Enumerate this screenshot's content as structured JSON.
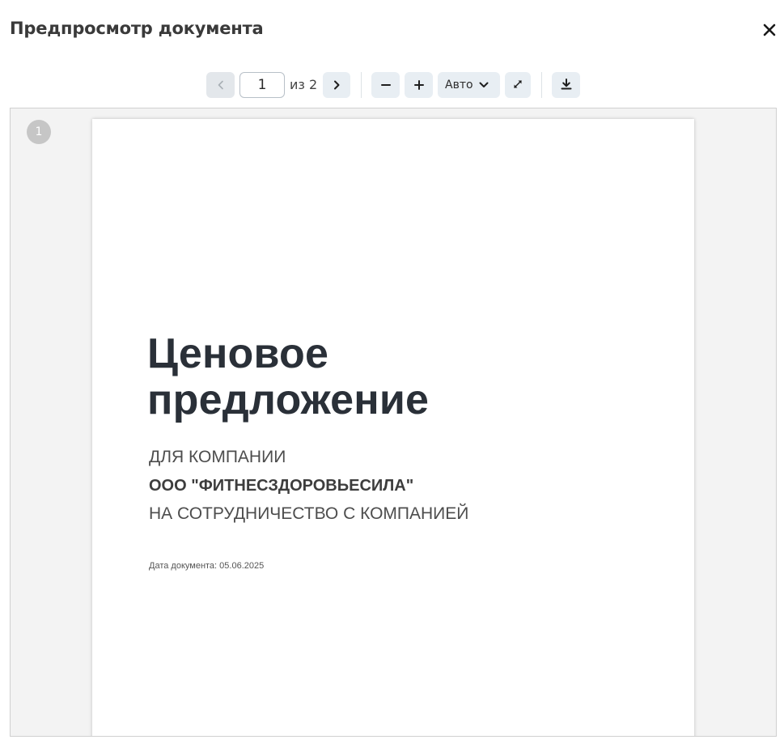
{
  "dialog": {
    "title": "Предпросмотр документа",
    "close_icon": "close-icon"
  },
  "toolbar": {
    "prev_icon": "chevron-left-icon",
    "page_current": "1",
    "page_of": "из 2",
    "next_icon": "chevron-right-icon",
    "zoom_out_icon": "minus-icon",
    "zoom_in_icon": "plus-icon",
    "zoom_value": "Авто",
    "zoom_dropdown_icon": "chevron-down-icon",
    "fullscreen_icon": "expand-icon",
    "download_icon": "download-icon"
  },
  "viewer": {
    "page_badge": "1",
    "document": {
      "title_line1": "Ценовое",
      "title_line2": "предложение",
      "line1": "ДЛЯ КОМПАНИИ",
      "line2": "ООО \"ФИТНЕСЗДОРОВЬЕСИЛА\"",
      "line3": "НА СОТРУДНИЧЕСТВО С КОМПАНИЕЙ",
      "date": "Дата документа: 05.06.2025"
    }
  },
  "colors": {
    "button_bg": "#e8eef3",
    "title_text": "#3a3a3a",
    "doc_title": "#2a3038"
  }
}
